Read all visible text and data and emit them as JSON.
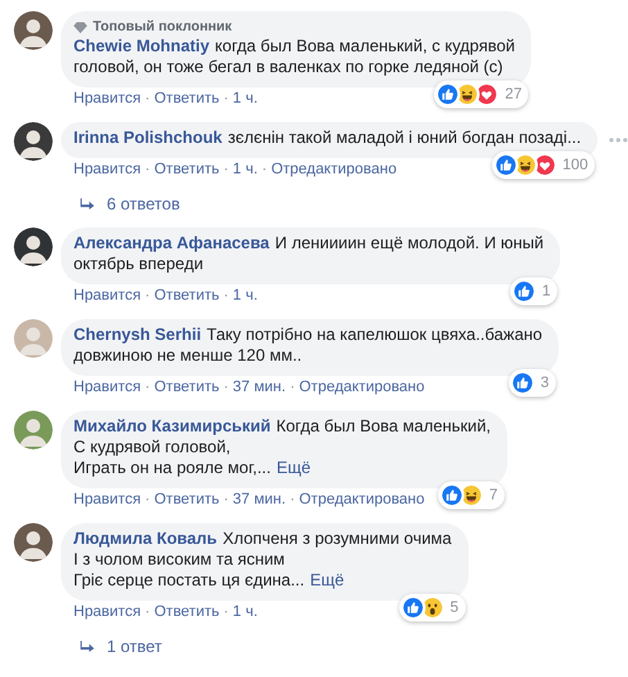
{
  "separator": "·",
  "items": [
    {
      "kind": "comment",
      "badge": "Топовый поклонник",
      "author": "Chewie Mohnatiy",
      "lines": [
        "когда был Вова маленький, с кудрявой",
        "головой, он тоже бегал в валенках по горке ледяной (с)"
      ],
      "reactions": [
        {
          "kind": "like"
        },
        {
          "kind": "haha"
        },
        {
          "kind": "love"
        }
      ],
      "reaction_count": "27",
      "actions": [
        "Нравится",
        "Ответить"
      ],
      "time": "1 ч."
    },
    {
      "kind": "comment",
      "author": "Irinna Polishchouk",
      "lines": [
        "зєлєнін такой маладой і юний богдан позаді..."
      ],
      "reactions": [
        {
          "kind": "like"
        },
        {
          "kind": "haha"
        },
        {
          "kind": "love"
        }
      ],
      "reaction_count": "100",
      "actions": [
        "Нравится",
        "Ответить"
      ],
      "time": "1 ч.",
      "edited": "Отредактировано",
      "options_shown": true
    },
    {
      "kind": "replies",
      "label": "6 ответов"
    },
    {
      "kind": "comment",
      "author": "Александра Афанасева",
      "lines": [
        "И лениииин ещё молодой. И юный",
        "октябрь впереди"
      ],
      "reactions": [
        {
          "kind": "like"
        }
      ],
      "reaction_count": "1",
      "actions": [
        "Нравится",
        "Ответить"
      ],
      "time": "1 ч."
    },
    {
      "kind": "comment",
      "author": "Chernysh Serhii",
      "lines": [
        "Таку потрібно на капелюшок цвяха..бажано",
        "довжиною не менше 120 мм.."
      ],
      "reactions": [
        {
          "kind": "like"
        }
      ],
      "reaction_count": "3",
      "actions": [
        "Нравится",
        "Ответить"
      ],
      "time": "37 мин.",
      "edited": "Отредактировано"
    },
    {
      "kind": "comment",
      "author": "Михайло Казимирський",
      "lines": [
        "Когда был Вова маленький,",
        "С кудрявой головой,",
        "Играть он на рояле мог,..."
      ],
      "more": "Ещё",
      "reactions": [
        {
          "kind": "like"
        },
        {
          "kind": "haha"
        }
      ],
      "reaction_count": "7",
      "actions": [
        "Нравится",
        "Ответить"
      ],
      "time": "37 мин.",
      "edited": "Отредактировано"
    },
    {
      "kind": "comment",
      "author": "Людмила Коваль",
      "lines": [
        "Хлопченя з розумними очима",
        "І з чолом високим та ясним",
        "Гріє серце постать ця єдина..."
      ],
      "more": "Ещё",
      "reactions": [
        {
          "kind": "like"
        },
        {
          "kind": "wow"
        }
      ],
      "reaction_count": "5",
      "actions": [
        "Нравится",
        "Ответить"
      ],
      "time": "1 ч."
    },
    {
      "kind": "replies",
      "label": "1 ответ"
    }
  ]
}
